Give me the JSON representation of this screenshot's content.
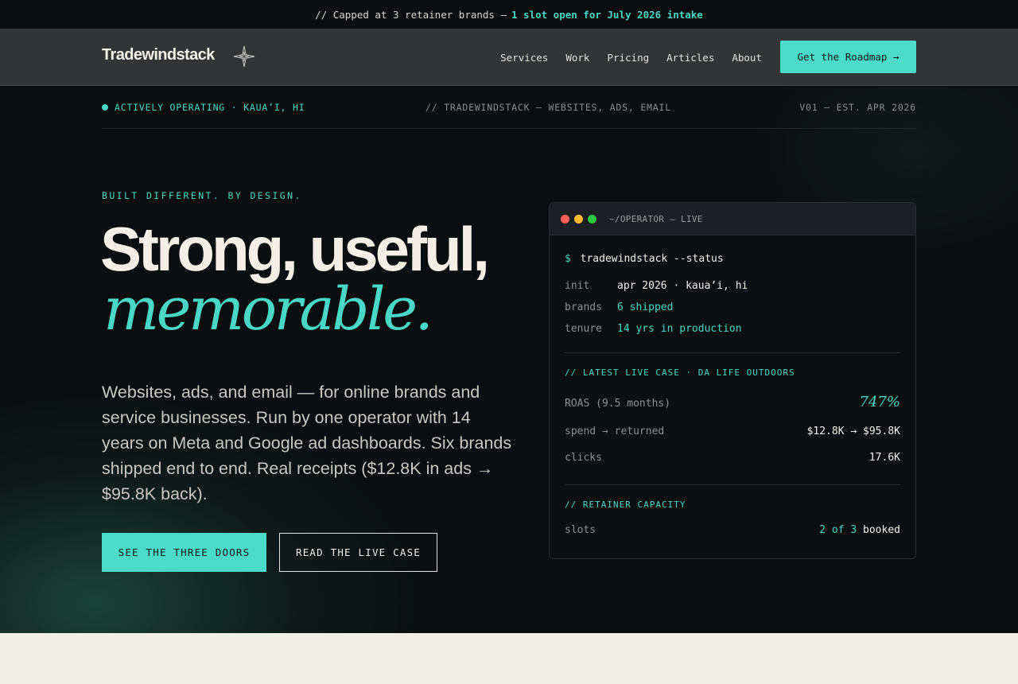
{
  "announcement": {
    "text": "// Capped at 3 retainer brands —",
    "highlight": "1 slot open for July 2026 intake"
  },
  "header": {
    "logo": "Tradewindstack",
    "logo_icon": "compass-star-icon",
    "nav": [
      "Services",
      "Work",
      "Pricing",
      "Articles",
      "About"
    ],
    "cta": "Get the Roadmap →"
  },
  "status_bar": {
    "left": "ACTIVELY OPERATING · KAUA’I, HI",
    "middle": "// TRADEWINDSTACK — WEBSITES, ADS, EMAIL",
    "right": "V01 — EST. APR 2026"
  },
  "hero": {
    "eyebrow": "BUILT DIFFERENT. BY DESIGN.",
    "headline_line1": "Strong, useful,",
    "headline_line2": "memorable.",
    "lede": "Websites, ads, and email — for online brands and service businesses. Run by one operator with 14 years on Meta and Google ad dashboards. Six brands shipped end to end. Real receipts ($12.8K in ads → $95.8K back).",
    "primary_button": "SEE THE THREE DOORS",
    "secondary_button": "READ THE LIVE CASE"
  },
  "terminal": {
    "title": "~/OPERATOR — LIVE",
    "prompt": "$",
    "command": "tradewindstack --status",
    "facts": [
      {
        "key": "init",
        "value": "apr 2026 · kaua’i, hi"
      },
      {
        "key": "brands",
        "value": "6 shipped"
      },
      {
        "key": "tenure",
        "value": "14 yrs in production"
      }
    ],
    "case_heading": "// LATEST LIVE CASE · DA LIFE OUTDOORS",
    "case_rows": [
      {
        "label": "ROAS (9.5 months)",
        "value": "747%"
      },
      {
        "label": "spend → returned",
        "value": "$12.8K → $95.8K"
      },
      {
        "label": "clicks",
        "value": "17.6K"
      }
    ],
    "capacity_heading": "// RETAINER CAPACITY",
    "capacity": {
      "label": "slots",
      "booked_count": "2 of 3",
      "booked_word": "booked"
    }
  },
  "colors": {
    "accent": "#4ddbc9",
    "background": "#0b0e10",
    "header_bg": "#323436",
    "cream": "#f2efe9"
  }
}
